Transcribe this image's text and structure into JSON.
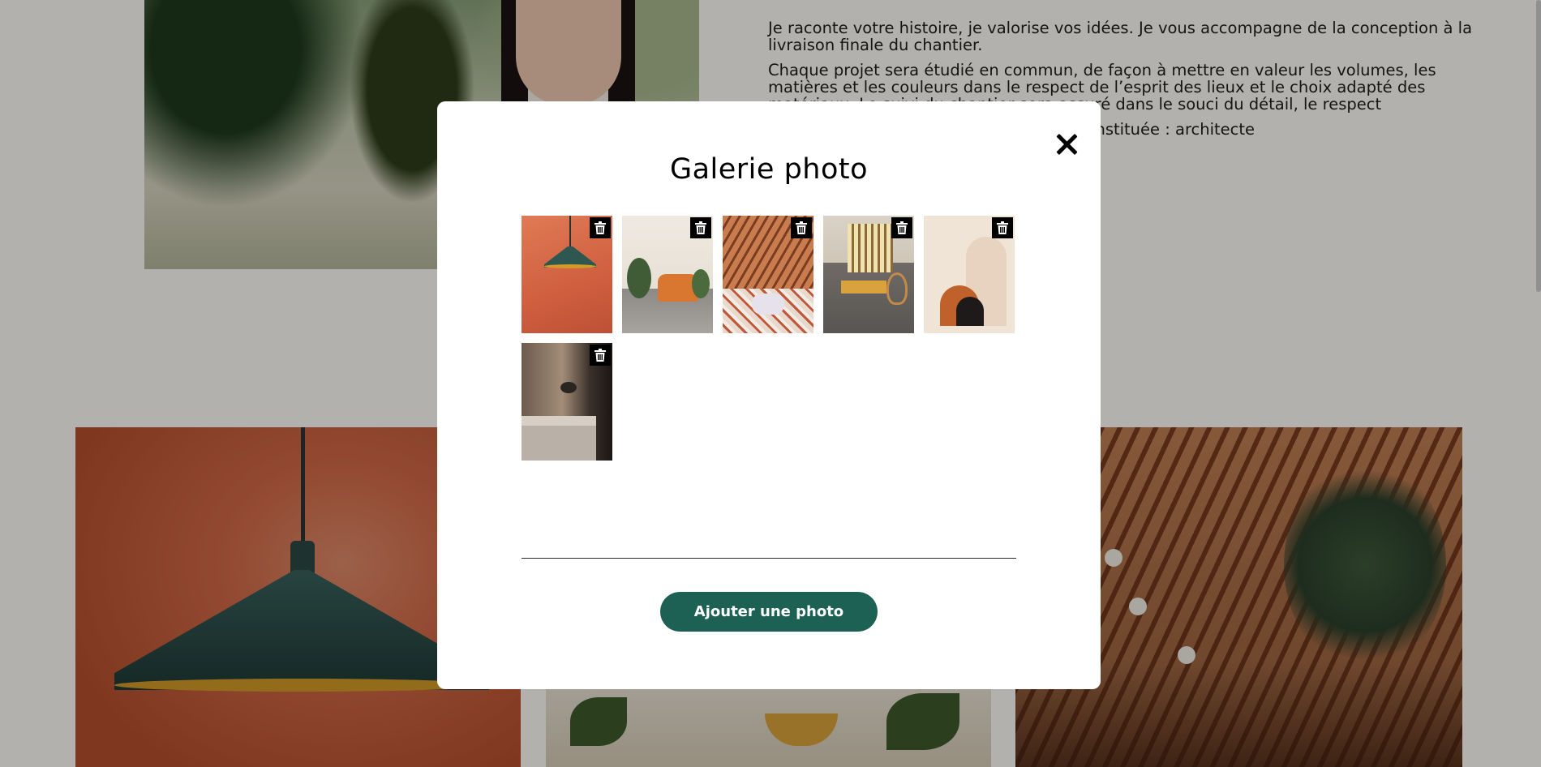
{
  "background": {
    "bio_paragraphs": [
      "Je raconte votre histoire, je valorise vos idées. Je vous accompagne de la conception à la livraison finale du chantier.",
      "Chaque projet sera étudié en commun, de façon à mettre en valeur les volumes, les matières et les couleurs dans le respect de l’esprit des lieux et le choix adapté des matériaux. Le suivi du chantier sera assuré dans le souci du détail, le respect",
      "Une équipe pluridisciplinaire peut-être constituée : architecte"
    ]
  },
  "modal": {
    "title": "Galerie photo",
    "close_icon": "close-icon",
    "photos": [
      {
        "subject": "orange-pendant-lamp",
        "delete_icon": "trash-icon"
      },
      {
        "subject": "living-room-orange-armchair",
        "delete_icon": "trash-icon"
      },
      {
        "subject": "restaurant-wood-roof",
        "delete_icon": "trash-icon"
      },
      {
        "subject": "sunlit-office-rattan-chair",
        "delete_icon": "trash-icon"
      },
      {
        "subject": "beige-arches-decor",
        "delete_icon": "trash-icon"
      },
      {
        "subject": "kitchen-wall-lamp",
        "delete_icon": "trash-icon"
      }
    ],
    "add_button_label": "Ajouter une photo",
    "colors": {
      "accent": "#1d6154",
      "overlay": "rgba(0,0,0,0.30)",
      "modal_bg": "#ffffff"
    }
  }
}
